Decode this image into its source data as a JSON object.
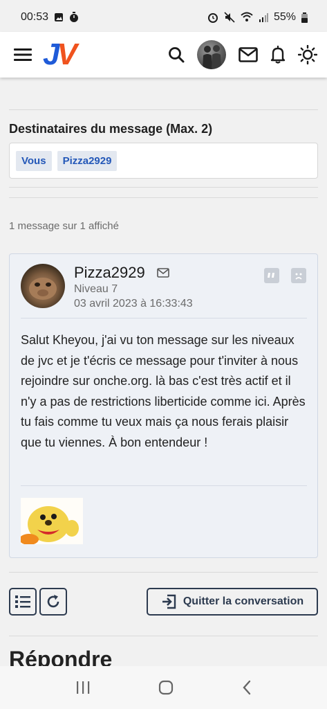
{
  "status_bar": {
    "time": "00:53",
    "battery": "55%"
  },
  "header": {
    "logo_j": "J",
    "logo_v": "V"
  },
  "recipients": {
    "title": "Destinataires du message (Max. 2)",
    "chips": [
      "Vous",
      "Pizza2929"
    ]
  },
  "message_count": "1 message sur 1 affiché",
  "message": {
    "author": "Pizza2929",
    "level": "Niveau 7",
    "date": "03 avril 2023 à 16:33:43",
    "body": "Salut Kheyou, j'ai vu ton message sur les niveaux de jvc et je t'écris ce message pour t'inviter à nous rejoindre sur onche.org. là bas c'est très actif et il n'y a pas de restrictions liberticide comme ici. Après tu fais comme tu veux mais ça nous ferais plaisir que tu viennes. À bon entendeur !"
  },
  "actions": {
    "quit_label": "Quitter la conversation"
  },
  "reply": {
    "title": "Répondre"
  },
  "icons": {
    "menu": "hamburger-menu-icon",
    "search": "search-icon",
    "mail": "envelope-icon",
    "bell": "bell-icon",
    "theme": "sun-icon",
    "list": "list-icon",
    "refresh": "refresh-icon",
    "exit": "exit-icon"
  },
  "colors": {
    "logo_blue": "#1f5bd8",
    "logo_orange": "#f0531e",
    "chip_text": "#2458b8",
    "button_border": "#2c3a4f",
    "message_bg": "#eef1f6"
  }
}
